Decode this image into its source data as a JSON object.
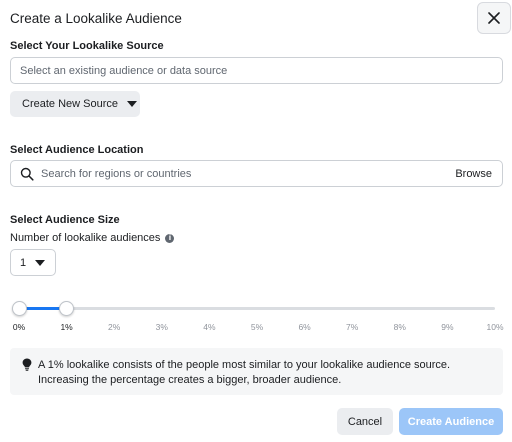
{
  "dialog": {
    "title": "Create a Lookalike Audience",
    "close_icon": "close-icon"
  },
  "source": {
    "label": "Select Your Lookalike Source",
    "placeholder": "Select an existing audience or data source",
    "create_button_label": "Create New Source"
  },
  "location": {
    "label": "Select Audience Location",
    "placeholder": "Search for regions or countries",
    "browse_label": "Browse",
    "icon": "search-icon"
  },
  "size": {
    "label": "Select Audience Size",
    "count_label": "Number of lookalike audiences",
    "count_value": "1",
    "slider_min_percent": 0,
    "slider_max_percent": 1,
    "ticks": [
      "0%",
      "1%",
      "2%",
      "3%",
      "4%",
      "5%",
      "6%",
      "7%",
      "8%",
      "9%",
      "10%"
    ]
  },
  "info": {
    "icon": "lightbulb-icon",
    "text": "A 1% lookalike consists of the people most similar to your lookalike audience source. Increasing the percentage creates a bigger, broader audience."
  },
  "footer": {
    "cancel_label": "Cancel",
    "create_label": "Create Audience"
  },
  "colors": {
    "accent": "#1877f2",
    "disabled_primary": "#9cc6f8"
  }
}
